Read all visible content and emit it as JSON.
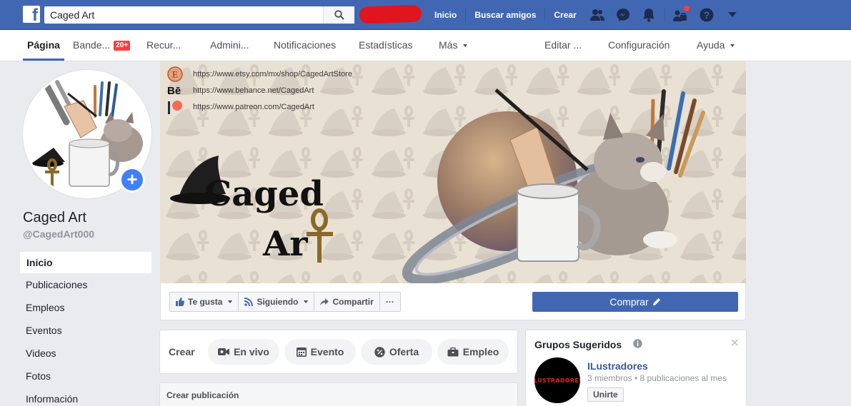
{
  "topbar": {
    "search_value": "Caged Art",
    "nav": [
      "Inicio",
      "Buscar amigos",
      "Crear"
    ]
  },
  "tabs": {
    "pagina": "Página",
    "bandeja": "Bande...",
    "bandeja_badge": "20+",
    "recursos": "Recur...",
    "admin": "Admini...",
    "notificaciones": "Notificaciones",
    "estadisticas": "Estadísticas",
    "mas": "Más",
    "editar": "Editar ...",
    "configuracion": "Configuración",
    "ayuda": "Ayuda"
  },
  "profile": {
    "name": "Caged Art",
    "handle": "@CagedArt000"
  },
  "leftnav": [
    "Inicio",
    "Publicaciones",
    "Empleos",
    "Eventos",
    "Videos",
    "Fotos",
    "Información"
  ],
  "cover": {
    "links": [
      "https://www.etsy.com/mx/shop/CagedArtStore",
      "https://www.behance.net/CagedArt",
      "https://www.patreon.com/CagedArt"
    ],
    "title_line1": "Caged",
    "title_line2": "Ar"
  },
  "actions": {
    "like": "Te gusta",
    "following": "Siguiendo",
    "share": "Compartir",
    "more": "···",
    "buy": "Comprar"
  },
  "create": {
    "label": "Crear",
    "live": "En vivo",
    "event": "Evento",
    "offer": "Oferta",
    "job": "Empleo"
  },
  "publication": {
    "title": "Crear publicación"
  },
  "groups": {
    "title": "Grupos Sugeridos",
    "group_name": "ILustradores",
    "avatar_text": "ILUSTRADORES",
    "meta": "3 miembros • 8 publicaciones al mes",
    "join": "Unirte"
  },
  "colors": {
    "fb_blue": "#4267b2",
    "accent": "#4080ff",
    "badge_red": "#fa3e3e"
  }
}
